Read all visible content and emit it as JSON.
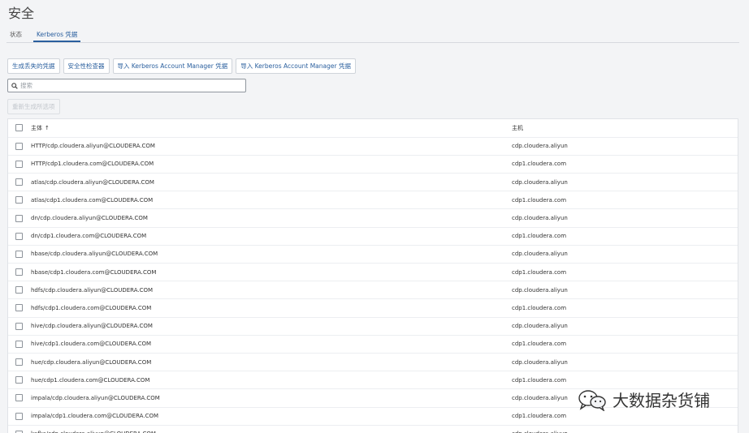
{
  "page": {
    "title": "安全"
  },
  "tabs": [
    {
      "label": "状态",
      "active": false
    },
    {
      "label": "Kerberos 凭据",
      "active": true
    }
  ],
  "toolbar": {
    "generate_missing": "生成丢失的凭据",
    "security_inspector": "安全性检查器",
    "import_kam_1": "导入 Kerberos Account Manager 凭据",
    "import_kam_2": "导入 Kerberos Account Manager 凭据"
  },
  "search": {
    "placeholder": "搜索",
    "value": ""
  },
  "regenerate": {
    "label": "重新生成所选项",
    "enabled": false
  },
  "table": {
    "headers": {
      "principal": "主体",
      "principal_sort": "↑",
      "host": "主机"
    },
    "rows": [
      {
        "principal": "HTTP/cdp.cloudera.aliyun@CLOUDERA.COM",
        "host": "cdp.cloudera.aliyun"
      },
      {
        "principal": "HTTP/cdp1.cloudera.com@CLOUDERA.COM",
        "host": "cdp1.cloudera.com"
      },
      {
        "principal": "atlas/cdp.cloudera.aliyun@CLOUDERA.COM",
        "host": "cdp.cloudera.aliyun"
      },
      {
        "principal": "atlas/cdp1.cloudera.com@CLOUDERA.COM",
        "host": "cdp1.cloudera.com"
      },
      {
        "principal": "dn/cdp.cloudera.aliyun@CLOUDERA.COM",
        "host": "cdp.cloudera.aliyun"
      },
      {
        "principal": "dn/cdp1.cloudera.com@CLOUDERA.COM",
        "host": "cdp1.cloudera.com"
      },
      {
        "principal": "hbase/cdp.cloudera.aliyun@CLOUDERA.COM",
        "host": "cdp.cloudera.aliyun"
      },
      {
        "principal": "hbase/cdp1.cloudera.com@CLOUDERA.COM",
        "host": "cdp1.cloudera.com"
      },
      {
        "principal": "hdfs/cdp.cloudera.aliyun@CLOUDERA.COM",
        "host": "cdp.cloudera.aliyun"
      },
      {
        "principal": "hdfs/cdp1.cloudera.com@CLOUDERA.COM",
        "host": "cdp1.cloudera.com"
      },
      {
        "principal": "hive/cdp.cloudera.aliyun@CLOUDERA.COM",
        "host": "cdp.cloudera.aliyun"
      },
      {
        "principal": "hive/cdp1.cloudera.com@CLOUDERA.COM",
        "host": "cdp1.cloudera.com"
      },
      {
        "principal": "hue/cdp.cloudera.aliyun@CLOUDERA.COM",
        "host": "cdp.cloudera.aliyun"
      },
      {
        "principal": "hue/cdp1.cloudera.com@CLOUDERA.COM",
        "host": "cdp1.cloudera.com"
      },
      {
        "principal": "impala/cdp.cloudera.aliyun@CLOUDERA.COM",
        "host": "cdp.cloudera.aliyun"
      },
      {
        "principal": "impala/cdp1.cloudera.com@CLOUDERA.COM",
        "host": "cdp1.cloudera.com"
      },
      {
        "principal": "kafka/cdp.cloudera.aliyun@CLOUDERA.COM",
        "host": "cdp.cloudera.aliyun"
      }
    ]
  },
  "watermark": {
    "text": "大数据杂货铺",
    "icon": "wechat-icon"
  }
}
